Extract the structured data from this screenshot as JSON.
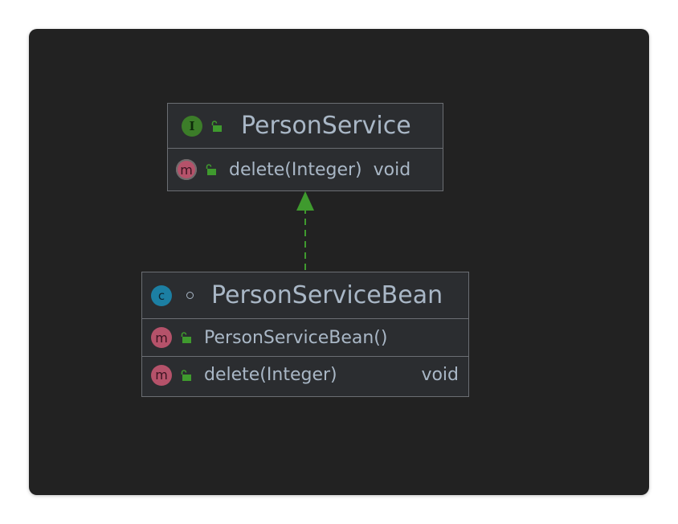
{
  "colors": {
    "background": "#222222",
    "node_fill": "#2b2d30",
    "node_border": "#6b6e73",
    "text": "#a9b7c6",
    "interface_badge": "#3c7d29",
    "class_badge": "#1c7fa3",
    "method_badge": "#b5526a",
    "public_lock": "#3f9a2e",
    "realization_arrow": "#3f9a2e"
  },
  "interface": {
    "badge": "I",
    "name": "PersonService",
    "visibility_icon": "public-lock-icon",
    "members": [
      {
        "badge": "m",
        "name": "delete(Integer)",
        "type": "void",
        "visibility_icon": "public-lock-icon"
      }
    ]
  },
  "class": {
    "badge": "c",
    "name": "PersonServiceBean",
    "visibility_icon": "package-private-dot-icon",
    "members": [
      {
        "badge": "m",
        "name": "PersonServiceBean()",
        "type": "",
        "visibility_icon": "public-lock-icon"
      },
      {
        "badge": "m",
        "name": "delete(Integer)",
        "type": "void",
        "visibility_icon": "public-lock-icon"
      }
    ]
  },
  "relation": {
    "kind": "realization",
    "line_style": "dashed",
    "from": "PersonServiceBean",
    "to": "PersonService"
  }
}
